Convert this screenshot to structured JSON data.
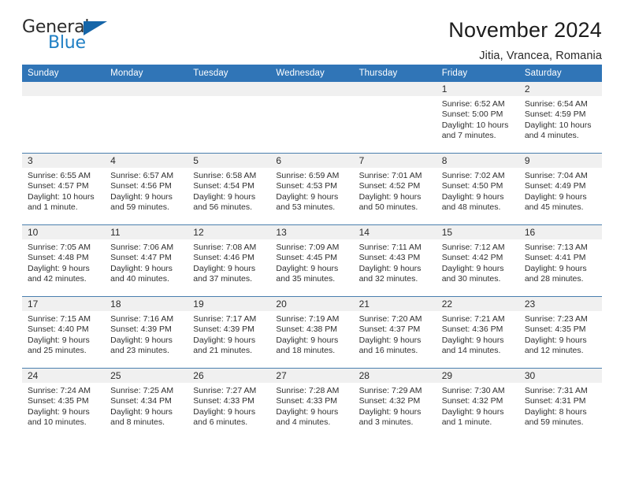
{
  "brand": {
    "name_part1": "General",
    "name_part2": "Blue",
    "triangle_color": "#1565a8",
    "blue_color": "#1f7fc4"
  },
  "header": {
    "title": "November 2024",
    "subtitle": "Jitia, Vrancea, Romania"
  },
  "theme": {
    "header_bg": "#3075b7",
    "daynum_bg": "#f0f0f0",
    "row_divider": "#4a7fae",
    "text": "#2f2f2f"
  },
  "weekday_headers": [
    "Sunday",
    "Monday",
    "Tuesday",
    "Wednesday",
    "Thursday",
    "Friday",
    "Saturday"
  ],
  "weeks": [
    [
      {
        "day": "",
        "sunrise": "",
        "sunset": "",
        "daylight": "",
        "empty": true
      },
      {
        "day": "",
        "sunrise": "",
        "sunset": "",
        "daylight": "",
        "empty": true
      },
      {
        "day": "",
        "sunrise": "",
        "sunset": "",
        "daylight": "",
        "empty": true
      },
      {
        "day": "",
        "sunrise": "",
        "sunset": "",
        "daylight": "",
        "empty": true
      },
      {
        "day": "",
        "sunrise": "",
        "sunset": "",
        "daylight": "",
        "empty": true
      },
      {
        "day": "1",
        "sunrise": "Sunrise: 6:52 AM",
        "sunset": "Sunset: 5:00 PM",
        "daylight": "Daylight: 10 hours and 7 minutes.",
        "empty": false
      },
      {
        "day": "2",
        "sunrise": "Sunrise: 6:54 AM",
        "sunset": "Sunset: 4:59 PM",
        "daylight": "Daylight: 10 hours and 4 minutes.",
        "empty": false
      }
    ],
    [
      {
        "day": "3",
        "sunrise": "Sunrise: 6:55 AM",
        "sunset": "Sunset: 4:57 PM",
        "daylight": "Daylight: 10 hours and 1 minute.",
        "empty": false
      },
      {
        "day": "4",
        "sunrise": "Sunrise: 6:57 AM",
        "sunset": "Sunset: 4:56 PM",
        "daylight": "Daylight: 9 hours and 59 minutes.",
        "empty": false
      },
      {
        "day": "5",
        "sunrise": "Sunrise: 6:58 AM",
        "sunset": "Sunset: 4:54 PM",
        "daylight": "Daylight: 9 hours and 56 minutes.",
        "empty": false
      },
      {
        "day": "6",
        "sunrise": "Sunrise: 6:59 AM",
        "sunset": "Sunset: 4:53 PM",
        "daylight": "Daylight: 9 hours and 53 minutes.",
        "empty": false
      },
      {
        "day": "7",
        "sunrise": "Sunrise: 7:01 AM",
        "sunset": "Sunset: 4:52 PM",
        "daylight": "Daylight: 9 hours and 50 minutes.",
        "empty": false
      },
      {
        "day": "8",
        "sunrise": "Sunrise: 7:02 AM",
        "sunset": "Sunset: 4:50 PM",
        "daylight": "Daylight: 9 hours and 48 minutes.",
        "empty": false
      },
      {
        "day": "9",
        "sunrise": "Sunrise: 7:04 AM",
        "sunset": "Sunset: 4:49 PM",
        "daylight": "Daylight: 9 hours and 45 minutes.",
        "empty": false
      }
    ],
    [
      {
        "day": "10",
        "sunrise": "Sunrise: 7:05 AM",
        "sunset": "Sunset: 4:48 PM",
        "daylight": "Daylight: 9 hours and 42 minutes.",
        "empty": false
      },
      {
        "day": "11",
        "sunrise": "Sunrise: 7:06 AM",
        "sunset": "Sunset: 4:47 PM",
        "daylight": "Daylight: 9 hours and 40 minutes.",
        "empty": false
      },
      {
        "day": "12",
        "sunrise": "Sunrise: 7:08 AM",
        "sunset": "Sunset: 4:46 PM",
        "daylight": "Daylight: 9 hours and 37 minutes.",
        "empty": false
      },
      {
        "day": "13",
        "sunrise": "Sunrise: 7:09 AM",
        "sunset": "Sunset: 4:45 PM",
        "daylight": "Daylight: 9 hours and 35 minutes.",
        "empty": false
      },
      {
        "day": "14",
        "sunrise": "Sunrise: 7:11 AM",
        "sunset": "Sunset: 4:43 PM",
        "daylight": "Daylight: 9 hours and 32 minutes.",
        "empty": false
      },
      {
        "day": "15",
        "sunrise": "Sunrise: 7:12 AM",
        "sunset": "Sunset: 4:42 PM",
        "daylight": "Daylight: 9 hours and 30 minutes.",
        "empty": false
      },
      {
        "day": "16",
        "sunrise": "Sunrise: 7:13 AM",
        "sunset": "Sunset: 4:41 PM",
        "daylight": "Daylight: 9 hours and 28 minutes.",
        "empty": false
      }
    ],
    [
      {
        "day": "17",
        "sunrise": "Sunrise: 7:15 AM",
        "sunset": "Sunset: 4:40 PM",
        "daylight": "Daylight: 9 hours and 25 minutes.",
        "empty": false
      },
      {
        "day": "18",
        "sunrise": "Sunrise: 7:16 AM",
        "sunset": "Sunset: 4:39 PM",
        "daylight": "Daylight: 9 hours and 23 minutes.",
        "empty": false
      },
      {
        "day": "19",
        "sunrise": "Sunrise: 7:17 AM",
        "sunset": "Sunset: 4:39 PM",
        "daylight": "Daylight: 9 hours and 21 minutes.",
        "empty": false
      },
      {
        "day": "20",
        "sunrise": "Sunrise: 7:19 AM",
        "sunset": "Sunset: 4:38 PM",
        "daylight": "Daylight: 9 hours and 18 minutes.",
        "empty": false
      },
      {
        "day": "21",
        "sunrise": "Sunrise: 7:20 AM",
        "sunset": "Sunset: 4:37 PM",
        "daylight": "Daylight: 9 hours and 16 minutes.",
        "empty": false
      },
      {
        "day": "22",
        "sunrise": "Sunrise: 7:21 AM",
        "sunset": "Sunset: 4:36 PM",
        "daylight": "Daylight: 9 hours and 14 minutes.",
        "empty": false
      },
      {
        "day": "23",
        "sunrise": "Sunrise: 7:23 AM",
        "sunset": "Sunset: 4:35 PM",
        "daylight": "Daylight: 9 hours and 12 minutes.",
        "empty": false
      }
    ],
    [
      {
        "day": "24",
        "sunrise": "Sunrise: 7:24 AM",
        "sunset": "Sunset: 4:35 PM",
        "daylight": "Daylight: 9 hours and 10 minutes.",
        "empty": false
      },
      {
        "day": "25",
        "sunrise": "Sunrise: 7:25 AM",
        "sunset": "Sunset: 4:34 PM",
        "daylight": "Daylight: 9 hours and 8 minutes.",
        "empty": false
      },
      {
        "day": "26",
        "sunrise": "Sunrise: 7:27 AM",
        "sunset": "Sunset: 4:33 PM",
        "daylight": "Daylight: 9 hours and 6 minutes.",
        "empty": false
      },
      {
        "day": "27",
        "sunrise": "Sunrise: 7:28 AM",
        "sunset": "Sunset: 4:33 PM",
        "daylight": "Daylight: 9 hours and 4 minutes.",
        "empty": false
      },
      {
        "day": "28",
        "sunrise": "Sunrise: 7:29 AM",
        "sunset": "Sunset: 4:32 PM",
        "daylight": "Daylight: 9 hours and 3 minutes.",
        "empty": false
      },
      {
        "day": "29",
        "sunrise": "Sunrise: 7:30 AM",
        "sunset": "Sunset: 4:32 PM",
        "daylight": "Daylight: 9 hours and 1 minute.",
        "empty": false
      },
      {
        "day": "30",
        "sunrise": "Sunrise: 7:31 AM",
        "sunset": "Sunset: 4:31 PM",
        "daylight": "Daylight: 8 hours and 59 minutes.",
        "empty": false
      }
    ]
  ]
}
